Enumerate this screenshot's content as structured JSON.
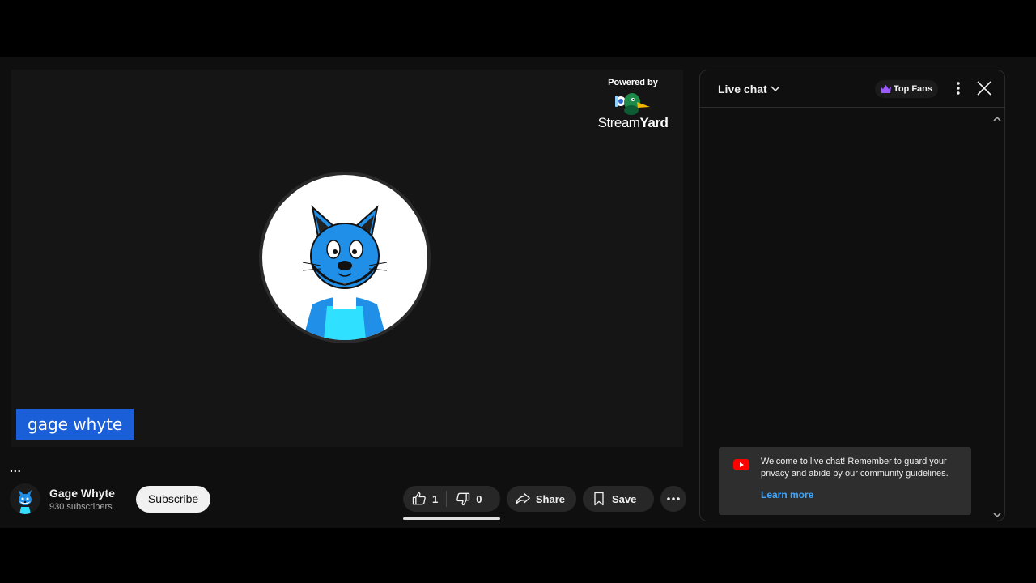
{
  "player": {
    "powered_by": "Powered by",
    "brand_name_part1": "Stream",
    "brand_name_part2": "Yard",
    "participant_name": "gage whyte",
    "more_label": "..."
  },
  "channel": {
    "name": "Gage Whyte",
    "subscribers": "930 subscribers",
    "subscribe_label": "Subscribe"
  },
  "actions": {
    "like_count": "1",
    "dislike_count": "0",
    "share_label": "Share",
    "save_label": "Save"
  },
  "chat": {
    "title": "Live chat",
    "top_fans_label": "Top Fans",
    "welcome_message": "Welcome to live chat! Remember to guard your privacy and abide by our community guidelines.",
    "learn_more": "Learn more"
  },
  "colors": {
    "accent_link": "#3ea6ff",
    "name_tag": "#1a5fd8",
    "youtube_red": "#ff0000",
    "avatar_blue": "#1f8fe8",
    "top_fans_crown": "#9b59ff"
  }
}
